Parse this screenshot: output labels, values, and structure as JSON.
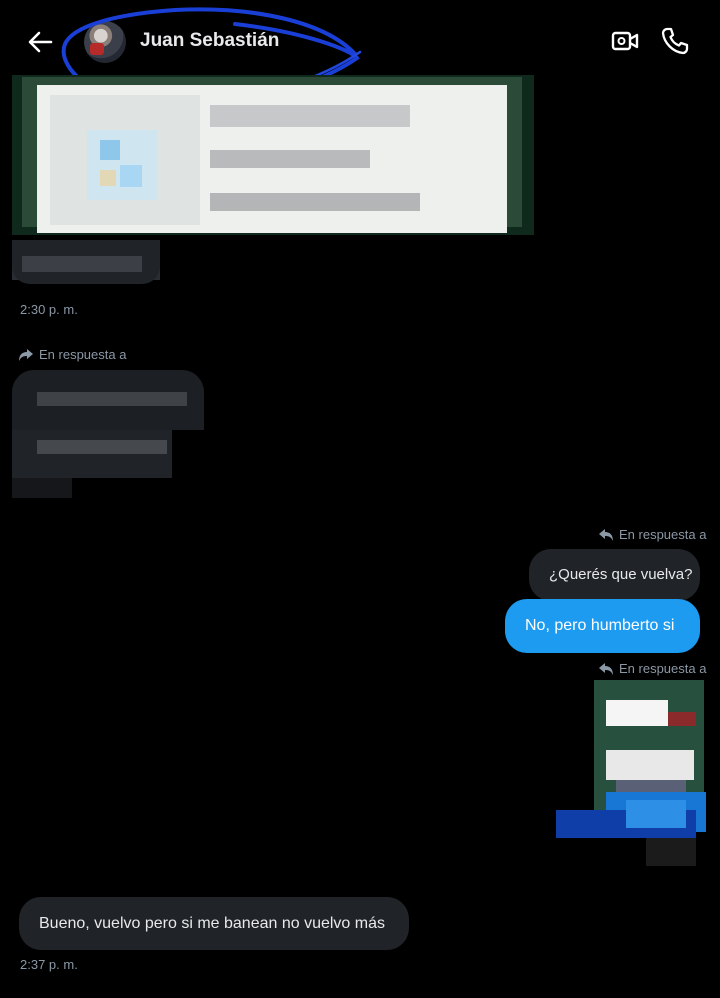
{
  "header": {
    "contact_name": "Juan Sebastián",
    "back_icon": "arrow-left-icon",
    "video_icon": "video-camera-icon",
    "call_icon": "phone-icon"
  },
  "messages": {
    "first_timestamp": "2:30 p. m.",
    "reply_label_incoming": "En respuesta a",
    "reply_label_outgoing_1": "En respuesta a",
    "quoted_text": "¿Querés que vuelva?",
    "my_reply": "No, pero humberto si",
    "reply_label_outgoing_2": "En respuesta a",
    "last_message": "Bueno, vuelvo pero si me banean no vuelvo más",
    "last_timestamp": "2:37 p. m."
  },
  "colors": {
    "background": "#000000",
    "bubble_incoming": "#202327",
    "bubble_outgoing": "#1d9bf0",
    "secondary_text": "#8b98a5",
    "scribble": "#1a3fd6"
  }
}
